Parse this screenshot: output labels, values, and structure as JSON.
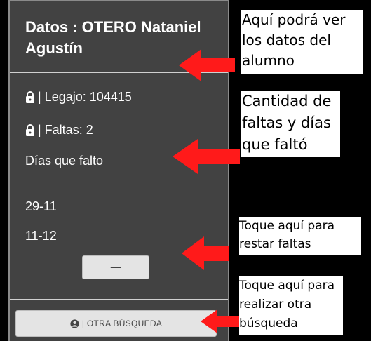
{
  "student": {
    "title": "Datos : OTERO Nataniel Agustín",
    "legajo": "| Legajo: 104415",
    "faltas": "| Faltas: 2",
    "dias_label": "Días que falto",
    "dates": [
      "29-11",
      "11-12"
    ]
  },
  "buttons": {
    "subtract_label": "—",
    "search_label": "| OTRA BÚSQUEDA"
  },
  "annotations": {
    "data": "Aquí podrá ver los datos del alumno",
    "count": "Cantidad de faltas y días que faltó",
    "subtract": "Toque aquí para restar faltas",
    "search": "Toque aquí para realizar otra búsqueda"
  },
  "colors": {
    "panel": "#424242",
    "arrow": "#ff1a1a"
  },
  "icons": [
    "lock-icon",
    "user-circle-icon",
    "arrow-left-icon"
  ]
}
